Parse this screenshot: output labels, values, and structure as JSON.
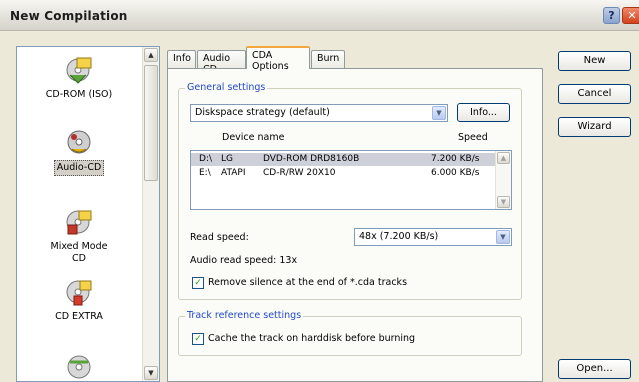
{
  "window": {
    "title": "New Compilation"
  },
  "titlebar": {
    "help_glyph": "?",
    "close_glyph": "✕"
  },
  "left_list": {
    "items": [
      {
        "label": "CD-ROM (ISO)",
        "icon": "cd-rom-iso-icon"
      },
      {
        "label": "Audio-CD",
        "icon": "audio-cd-icon",
        "selected": true
      },
      {
        "label": "Mixed Mode CD",
        "icon": "mixed-mode-cd-icon"
      },
      {
        "label": "CD EXTRA",
        "icon": "cd-extra-icon"
      },
      {
        "label": "",
        "icon": "cd-icon"
      }
    ]
  },
  "tabs": [
    {
      "label": "Info"
    },
    {
      "label": "Audio CD"
    },
    {
      "label": "CDA Options",
      "active": true
    },
    {
      "label": "Burn"
    }
  ],
  "general_settings": {
    "title": "General settings",
    "strategy_value": "Diskspace strategy (default)",
    "info_button": "Info...",
    "col_device": "Device name",
    "col_speed": "Speed",
    "devices": [
      {
        "drive": "D:\\",
        "vendor": "LG",
        "model": "DVD-ROM DRD8160B",
        "speed": "7.200 KB/s",
        "selected": true
      },
      {
        "drive": "E:\\",
        "vendor": "ATAPI",
        "model": "CD-R/RW 20X10",
        "speed": "6.000 KB/s"
      }
    ],
    "read_speed_label": "Read speed:",
    "read_speed_value": "48x (7.200 KB/s)",
    "audio_read_speed": "Audio read speed: 13x",
    "remove_silence_label": "Remove silence at the end of *.cda tracks",
    "remove_silence_checked": true
  },
  "track_reference": {
    "title": "Track reference settings",
    "cache_label": "Cache the track on harddisk before burning",
    "cache_checked": true
  },
  "side_buttons": {
    "new": "New",
    "cancel": "Cancel",
    "wizard": "Wizard",
    "open": "Open..."
  },
  "colors": {
    "accent_tab": "#f5a73b",
    "group_title": "#2149c5",
    "selection": "#cdd0d9"
  }
}
